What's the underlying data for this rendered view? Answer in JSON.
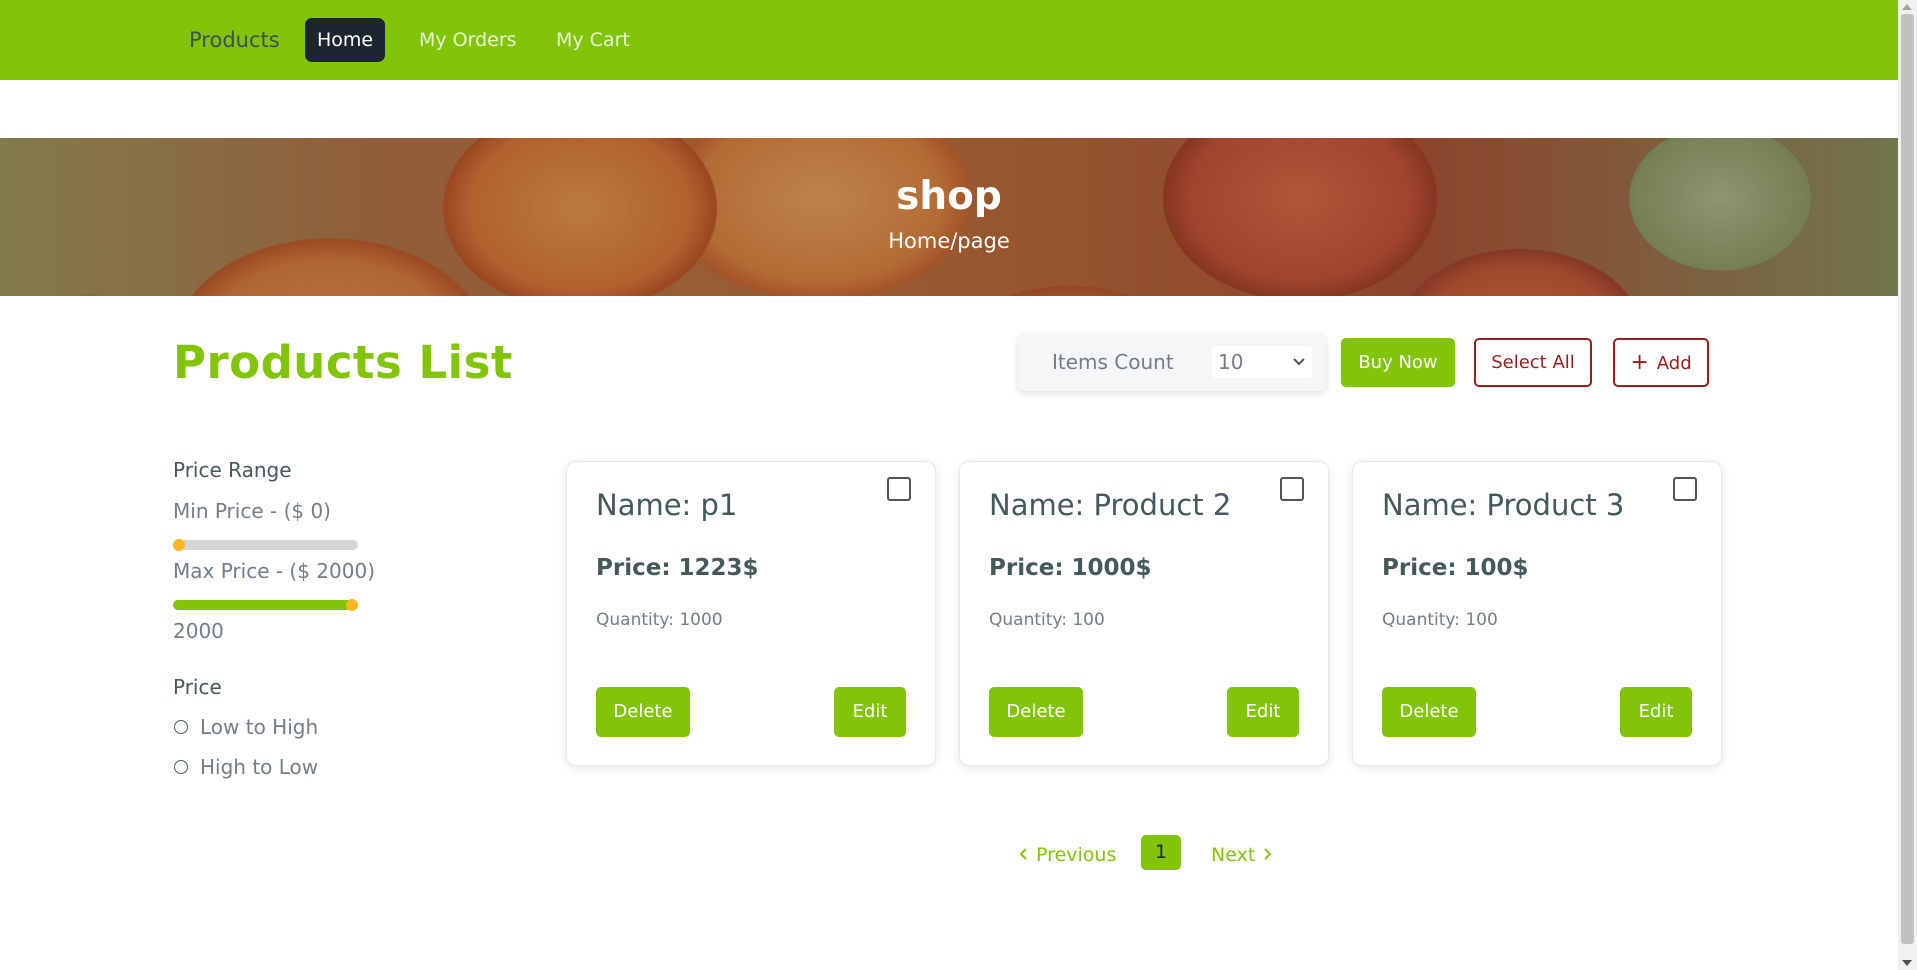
{
  "nav": {
    "brand": "Products",
    "items": [
      {
        "label": "Home",
        "active": true
      },
      {
        "label": "My Orders",
        "active": false
      },
      {
        "label": "My Cart",
        "active": false
      }
    ]
  },
  "hero": {
    "title": "shop",
    "breadcrumb": "Home/page"
  },
  "main": {
    "title": "Products List",
    "items_count_label": "Items Count",
    "items_count_value": "10",
    "buy_now_label": "Buy Now",
    "select_all_label": "Select All",
    "add_label": "Add"
  },
  "sidebar": {
    "price_range_heading": "Price Range",
    "min_price_label": "Min Price - ($ 0)",
    "min_price_value": 0,
    "max_price_label": "Max Price - ($ 2000)",
    "max_price_value": 2000,
    "current_value": "2000",
    "price_heading": "Price",
    "sort_options": [
      "Low to High",
      "High to Low"
    ]
  },
  "products": [
    {
      "name": "Name: p1",
      "price": "Price: 1223$",
      "quantity": "Quantity: 1000",
      "delete_label": "Delete",
      "edit_label": "Edit"
    },
    {
      "name": "Name: Product 2",
      "price": "Price: 1000$",
      "quantity": "Quantity: 100",
      "delete_label": "Delete",
      "edit_label": "Edit"
    },
    {
      "name": "Name: Product 3",
      "price": "Price: 100$",
      "quantity": "Quantity: 100",
      "delete_label": "Delete",
      "edit_label": "Edit"
    }
  ],
  "pagination": {
    "previous_label": "Previous",
    "current_page": "1",
    "next_label": "Next"
  },
  "colors": {
    "accent": "#81c408",
    "dark": "#1c2530",
    "danger": "#9b1c1c",
    "thumb": "#ffb524"
  }
}
